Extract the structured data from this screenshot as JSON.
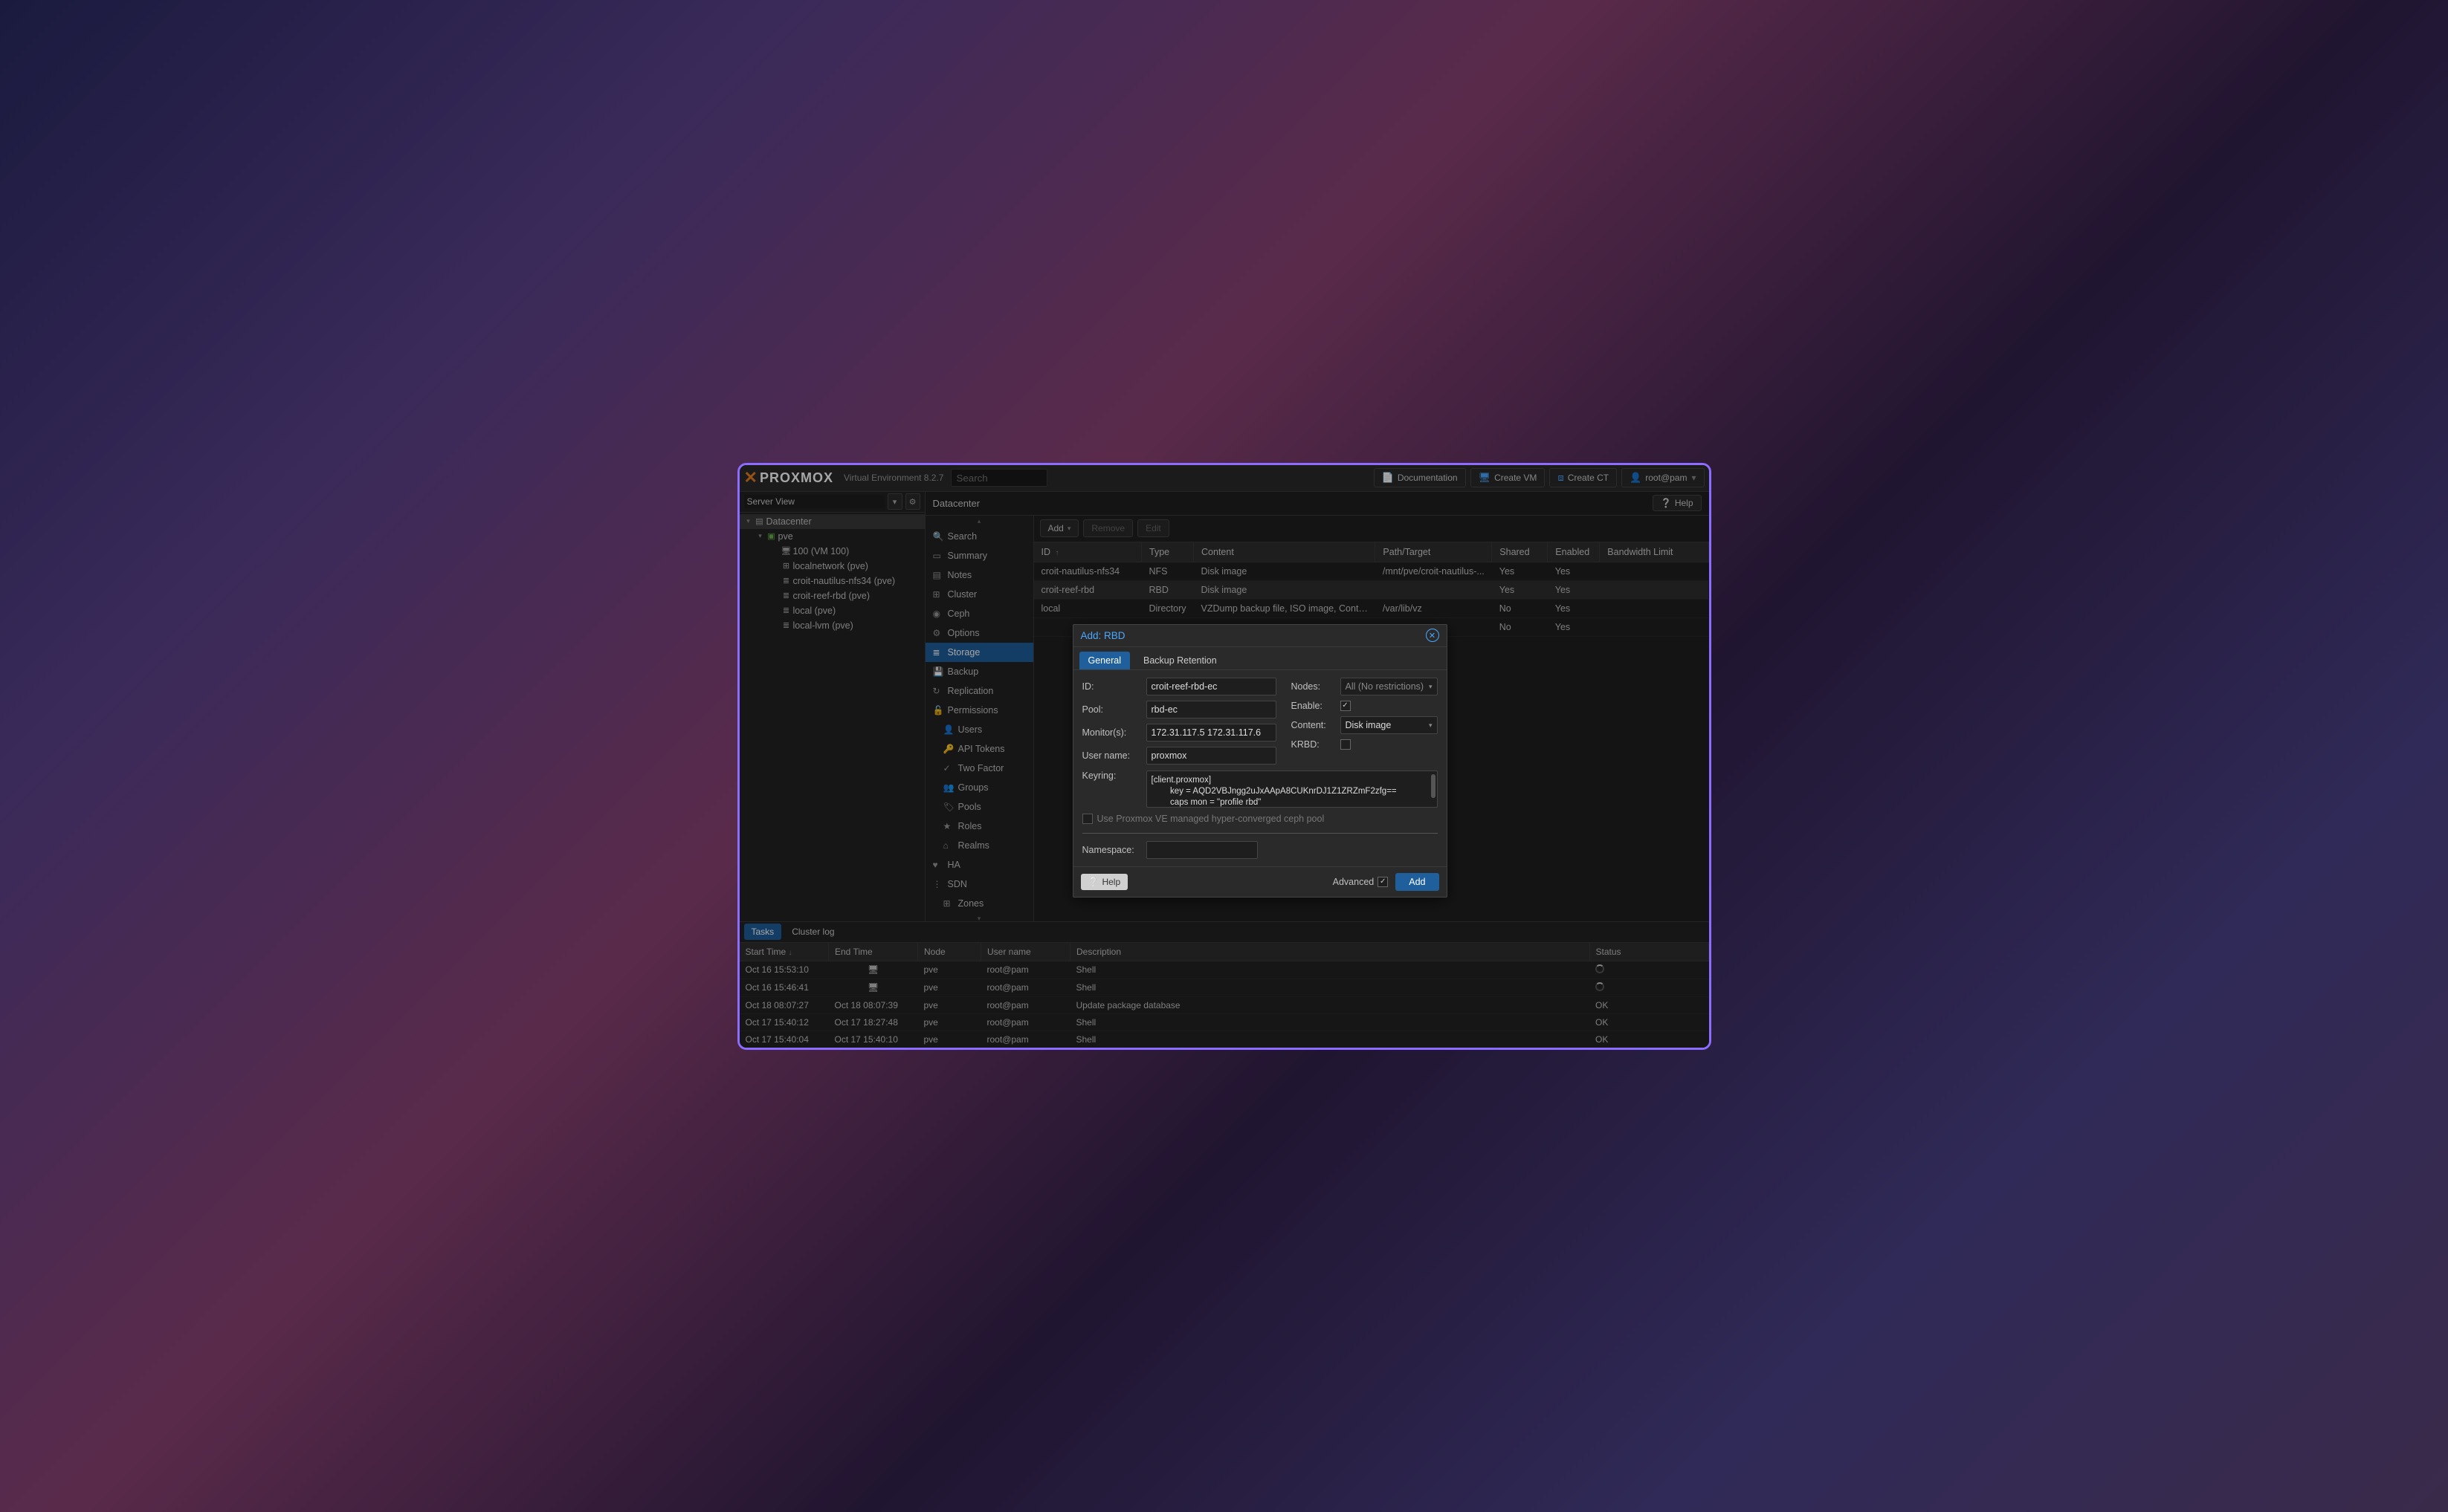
{
  "header": {
    "product": "PROXMOX",
    "subtitle": "Virtual Environment 8.2.7",
    "search_placeholder": "Search",
    "documentation": "Documentation",
    "create_vm": "Create VM",
    "create_ct": "Create CT",
    "user": "root@pam"
  },
  "left_panel": {
    "view": "Server View",
    "tree": {
      "datacenter": "Datacenter",
      "node": "pve",
      "items": [
        {
          "icon": "monitor",
          "label": "100 (VM 100)"
        },
        {
          "icon": "net",
          "label": "localnetwork (pve)"
        },
        {
          "icon": "disks",
          "label": "croit-nautilus-nfs34 (pve)"
        },
        {
          "icon": "disks",
          "label": "croit-reef-rbd (pve)"
        },
        {
          "icon": "disks",
          "label": "local (pve)"
        },
        {
          "icon": "disks",
          "label": "local-lvm (pve)"
        }
      ]
    }
  },
  "crumb": {
    "title": "Datacenter",
    "help": "Help"
  },
  "sidemenu": [
    {
      "icon": "search",
      "label": "Search"
    },
    {
      "icon": "book",
      "label": "Summary"
    },
    {
      "icon": "note",
      "label": "Notes"
    },
    {
      "icon": "cluster",
      "label": "Cluster"
    },
    {
      "icon": "ceph",
      "label": "Ceph"
    },
    {
      "icon": "gear",
      "label": "Options"
    },
    {
      "icon": "storage",
      "label": "Storage",
      "selected": true
    },
    {
      "icon": "save",
      "label": "Backup"
    },
    {
      "icon": "repl",
      "label": "Replication"
    },
    {
      "icon": "lock",
      "label": "Permissions"
    },
    {
      "icon": "user",
      "label": "Users",
      "sub": true
    },
    {
      "icon": "key",
      "label": "API Tokens",
      "sub": true
    },
    {
      "icon": "2fa",
      "label": "Two Factor",
      "sub": true
    },
    {
      "icon": "group",
      "label": "Groups",
      "sub": true
    },
    {
      "icon": "tag",
      "label": "Pools",
      "sub": true
    },
    {
      "icon": "role",
      "label": "Roles",
      "sub": true
    },
    {
      "icon": "realm",
      "label": "Realms",
      "sub": true
    },
    {
      "icon": "ha",
      "label": "HA"
    },
    {
      "icon": "sdn",
      "label": "SDN"
    },
    {
      "icon": "zones",
      "label": "Zones",
      "sub": true
    }
  ],
  "toolbar": {
    "add": "Add",
    "remove": "Remove",
    "edit": "Edit"
  },
  "storage_table": {
    "columns": [
      "ID",
      "Type",
      "Content",
      "Path/Target",
      "Shared",
      "Enabled",
      "Bandwidth Limit"
    ],
    "sort_arrow": "↑",
    "rows": [
      {
        "id": "croit-nautilus-nfs34",
        "type": "NFS",
        "content": "Disk image",
        "path": "/mnt/pve/croit-nautilus-...",
        "shared": "Yes",
        "enabled": "Yes",
        "bw": ""
      },
      {
        "id": "croit-reef-rbd",
        "type": "RBD",
        "content": "Disk image",
        "path": "",
        "shared": "Yes",
        "enabled": "Yes",
        "bw": ""
      },
      {
        "id": "local",
        "type": "Directory",
        "content": "VZDump backup file, ISO image, Cont…",
        "path": "/var/lib/vz",
        "shared": "No",
        "enabled": "Yes",
        "bw": ""
      },
      {
        "id": "",
        "type": "",
        "content": "",
        "path": "",
        "shared": "No",
        "enabled": "Yes",
        "bw": ""
      }
    ]
  },
  "tasks_panel": {
    "tabs": {
      "tasks": "Tasks",
      "cluster_log": "Cluster log"
    },
    "columns": [
      "Start Time",
      "End Time",
      "Node",
      "User name",
      "Description",
      "Status"
    ],
    "sort_arrow": "↓",
    "rows": [
      {
        "start": "Oct 16 15:53:10",
        "end_icon": true,
        "end": "",
        "node": "pve",
        "user": "root@pam",
        "desc": "Shell",
        "status_spinner": true,
        "status": ""
      },
      {
        "start": "Oct 16 15:46:41",
        "end_icon": true,
        "end": "",
        "node": "pve",
        "user": "root@pam",
        "desc": "Shell",
        "status_spinner": true,
        "status": ""
      },
      {
        "start": "Oct 18 08:07:27",
        "end": "Oct 18 08:07:39",
        "node": "pve",
        "user": "root@pam",
        "desc": "Update package database",
        "status": "OK"
      },
      {
        "start": "Oct 17 15:40:12",
        "end": "Oct 17 18:27:48",
        "node": "pve",
        "user": "root@pam",
        "desc": "Shell",
        "status": "OK"
      },
      {
        "start": "Oct 17 15:40:04",
        "end": "Oct 17 15:40:10",
        "node": "pve",
        "user": "root@pam",
        "desc": "Shell",
        "status": "OK"
      }
    ]
  },
  "dialog": {
    "title": "Add: RBD",
    "tabs": {
      "general": "General",
      "backup": "Backup Retention"
    },
    "fields": {
      "id_label": "ID:",
      "id_value": "croit-reef-rbd-ec",
      "pool_label": "Pool:",
      "pool_value": "rbd-ec",
      "monitors_label": "Monitor(s):",
      "monitors_value": "172.31.117.5 172.31.117.6",
      "username_label": "User name:",
      "username_value": "proxmox",
      "nodes_label": "Nodes:",
      "nodes_value": "All (No restrictions)",
      "enable_label": "Enable:",
      "enable_checked": true,
      "content_label": "Content:",
      "content_value": "Disk image",
      "krbd_label": "KRBD:",
      "krbd_checked": false,
      "keyring_label": "Keyring:",
      "keyring_value": "[client.proxmox]\n        key = AQD2VBJngg2uJxAApA8CUKnrDJ1Z1ZRZmF2zfg==\n        caps mon = \"profile rbd\"\n        caps osd = \"profile rbd pool=rbd, profile rbd pool=rbd-ec\"",
      "managed_label": "Use Proxmox VE managed hyper-converged ceph pool",
      "namespace_label": "Namespace:",
      "namespace_value": ""
    },
    "footer": {
      "help": "Help",
      "advanced": "Advanced",
      "add": "Add"
    }
  }
}
